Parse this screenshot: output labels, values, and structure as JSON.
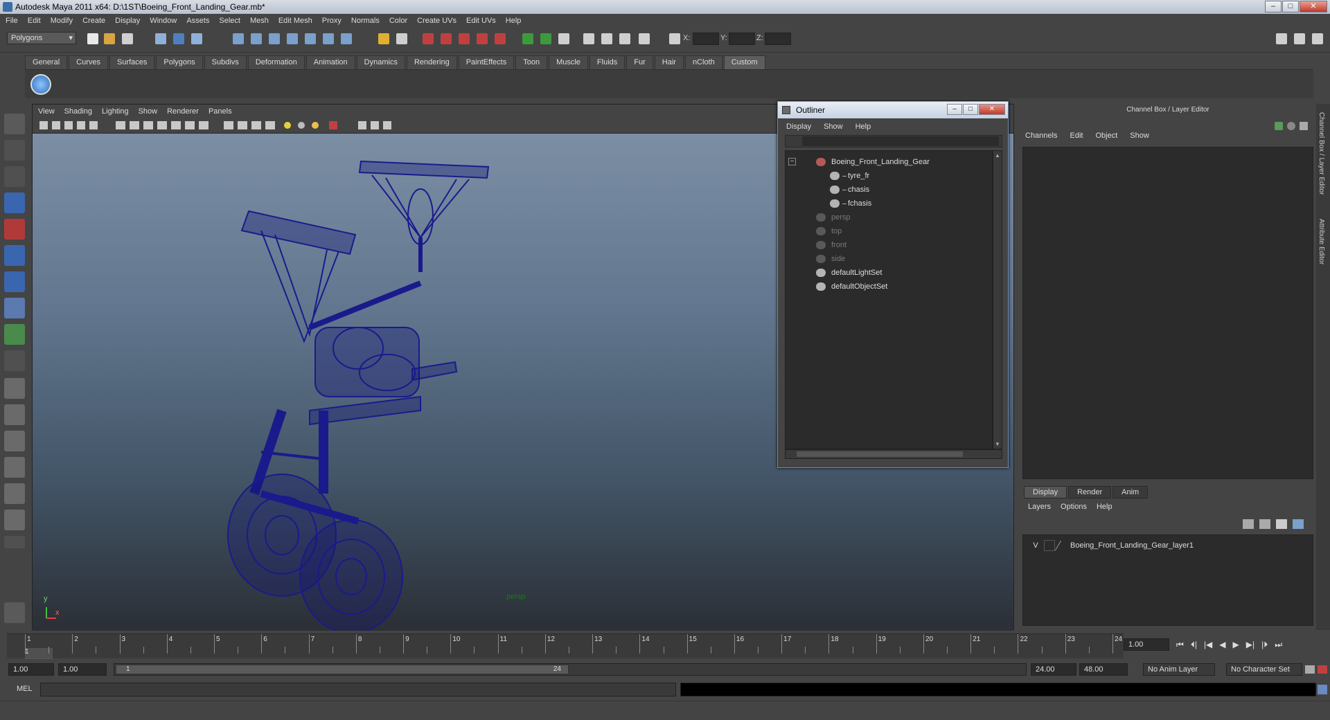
{
  "window": {
    "title": "Autodesk Maya 2011 x64: D:\\1ST\\Boeing_Front_Landing_Gear.mb*"
  },
  "menubar": [
    "File",
    "Edit",
    "Modify",
    "Create",
    "Display",
    "Window",
    "Assets",
    "Select",
    "Mesh",
    "Edit Mesh",
    "Proxy",
    "Normals",
    "Color",
    "Create UVs",
    "Edit UVs",
    "Help"
  ],
  "status": {
    "mode": "Polygons",
    "x_label": "X:",
    "y_label": "Y:",
    "z_label": "Z:"
  },
  "shelf_tabs": [
    "General",
    "Curves",
    "Surfaces",
    "Polygons",
    "Subdivs",
    "Deformation",
    "Animation",
    "Dynamics",
    "Rendering",
    "PaintEffects",
    "Toon",
    "Muscle",
    "Fluids",
    "Fur",
    "Hair",
    "nCloth",
    "Custom"
  ],
  "viewport": {
    "menu": [
      "View",
      "Shading",
      "Lighting",
      "Show",
      "Renderer",
      "Panels"
    ],
    "camera_label": "persp",
    "axis_y": "y",
    "axis_x": "x"
  },
  "outliner": {
    "title": "Outliner",
    "menu": [
      "Display",
      "Show",
      "Help"
    ],
    "items": [
      {
        "label": "Boeing_Front_Landing_Gear",
        "indent": 0,
        "dim": false,
        "icon": "group-icon",
        "color": "#d06060"
      },
      {
        "label": "tyre_fr",
        "indent": 1,
        "dim": false,
        "icon": "mesh-icon",
        "color": "#cccccc"
      },
      {
        "label": "chasis",
        "indent": 1,
        "dim": false,
        "icon": "mesh-icon",
        "color": "#cccccc"
      },
      {
        "label": "fchasis",
        "indent": 1,
        "dim": false,
        "icon": "mesh-icon",
        "color": "#cccccc"
      },
      {
        "label": "persp",
        "indent": 0,
        "dim": true,
        "icon": "camera-icon",
        "color": "#888888"
      },
      {
        "label": "top",
        "indent": 0,
        "dim": true,
        "icon": "camera-icon",
        "color": "#888888"
      },
      {
        "label": "front",
        "indent": 0,
        "dim": true,
        "icon": "camera-icon",
        "color": "#888888"
      },
      {
        "label": "side",
        "indent": 0,
        "dim": true,
        "icon": "camera-icon",
        "color": "#888888"
      },
      {
        "label": "defaultLightSet",
        "indent": 0,
        "dim": false,
        "icon": "set-icon",
        "color": "#cccccc"
      },
      {
        "label": "defaultObjectSet",
        "indent": 0,
        "dim": false,
        "icon": "set-icon",
        "color": "#cccccc"
      }
    ]
  },
  "channel_box": {
    "header": "Channel Box / Layer Editor",
    "menu": [
      "Channels",
      "Edit",
      "Object",
      "Show"
    ],
    "layer_tabs": [
      "Display",
      "Render",
      "Anim"
    ],
    "layer_menu": [
      "Layers",
      "Options",
      "Help"
    ],
    "layer_visible": "V",
    "layer_name": "Boeing_Front_Landing_Gear_layer1"
  },
  "side_tabs": [
    "Channel Box / Layer Editor",
    "Attribute Editor"
  ],
  "timeline": {
    "ticks": [
      "1",
      "2",
      "3",
      "4",
      "5",
      "6",
      "7",
      "8",
      "9",
      "10",
      "11",
      "12",
      "13",
      "14",
      "15",
      "16",
      "17",
      "18",
      "19",
      "20",
      "21",
      "22",
      "23",
      "24"
    ],
    "current_marker": "1",
    "current_frame": "1.00"
  },
  "range": {
    "start": "1.00",
    "start2": "1.00",
    "slider_start": "1",
    "slider_end": "24",
    "end": "24.00",
    "end2": "48.00",
    "anim_layer": "No Anim Layer",
    "char_set": "No Character Set"
  },
  "cmd": {
    "label": "MEL"
  }
}
